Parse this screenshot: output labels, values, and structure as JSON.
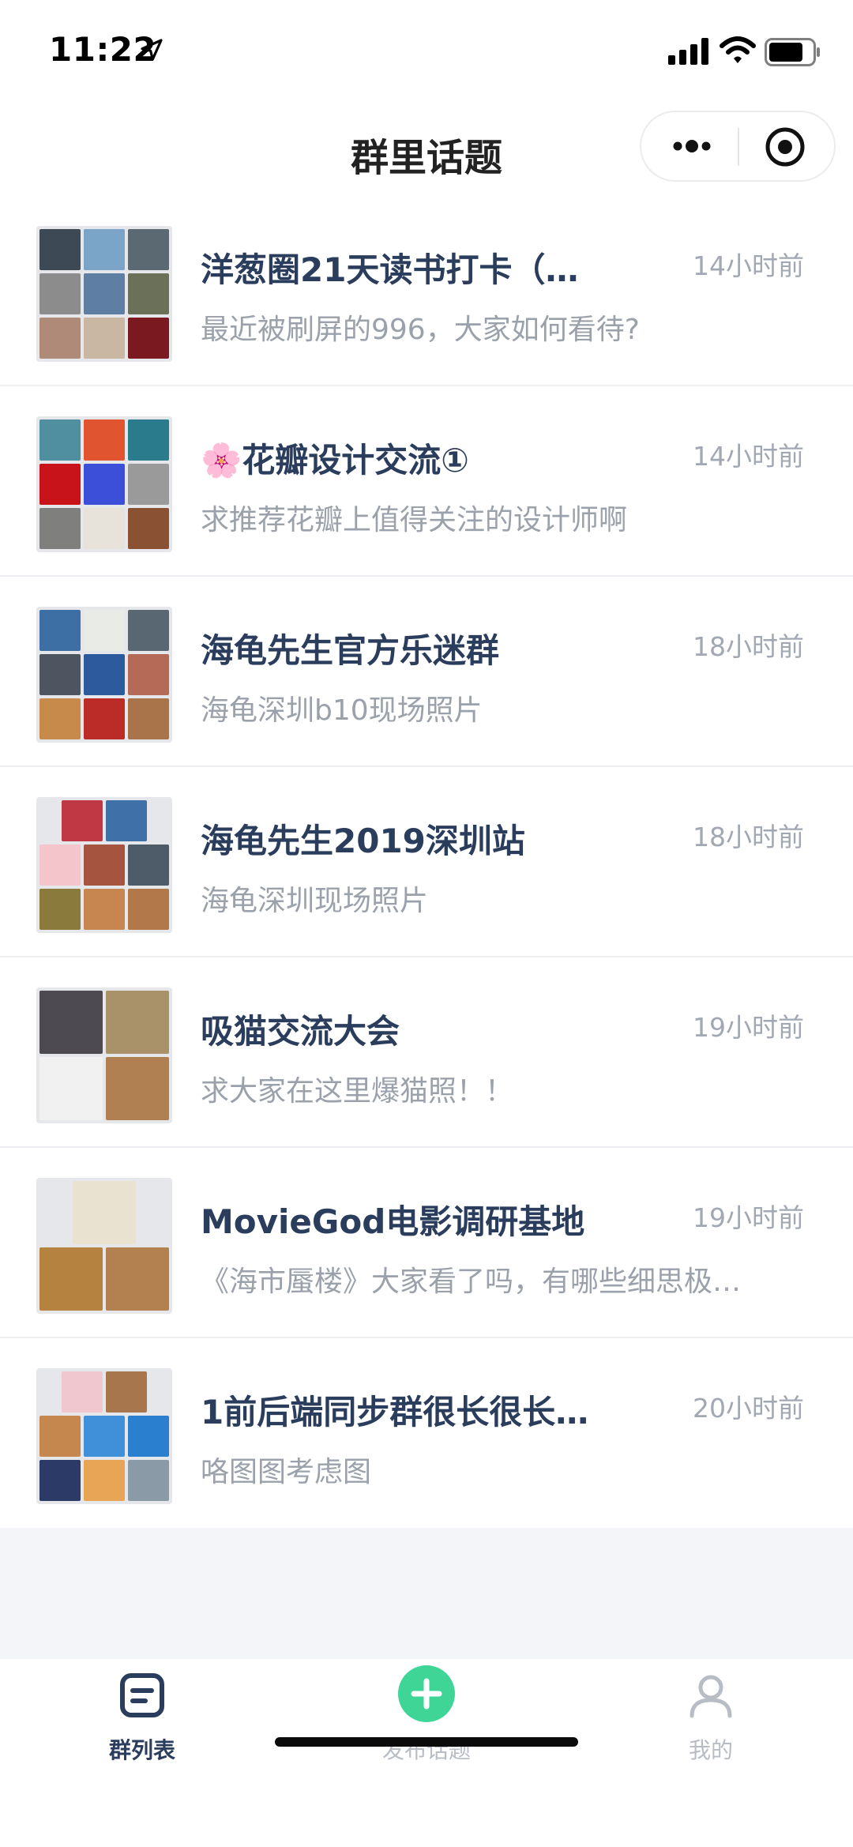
{
  "status_bar": {
    "time": "11:22"
  },
  "nav": {
    "title": "群里话题"
  },
  "groups": [
    {
      "name": "洋葱圈21天读书打卡（…",
      "time": "14小时前",
      "desc": "最近被刷屏的996，大家如何看待?",
      "avatar_colors": [
        "#3d4a56",
        "#7aa4c8",
        "#5b6a72",
        "#8c8c8c",
        "#5f7ea3",
        "#6b7058",
        "#b08a78",
        "#c9b7a4",
        "#7a1a20"
      ]
    },
    {
      "name": "🌸花瓣设计交流①",
      "time": "14小时前",
      "desc": "求推荐花瓣上值得关注的设计师啊",
      "avatar_colors": [
        "#4f8fa0",
        "#e0552f",
        "#2a7c8c",
        "#c9131b",
        "#3b4fd8",
        "#9a9a9a",
        "#7f807d",
        "#e7e2da",
        "#8a5232"
      ]
    },
    {
      "name": "海龟先生官方乐迷群",
      "time": "18小时前",
      "desc": "海龟深圳b10现场照片",
      "avatar_colors": [
        "#3d6fa5",
        "#e9ebe6",
        "#596772",
        "#4f5560",
        "#2c5a9c",
        "#b46a57",
        "#c88a4a",
        "#bb2c28",
        "#a9744a"
      ]
    },
    {
      "name": "海龟先生2019深圳站",
      "time": "18小时前",
      "desc": "海龟深圳现场照片",
      "avatar_colors": [
        "#c13845",
        "#3f71a8",
        "#f4c6cc",
        "#a5553f",
        "#4e5b68",
        "#8a7a3c",
        "#c7864f",
        "#b3784a"
      ]
    },
    {
      "name": "吸猫交流大会",
      "time": "19小时前",
      "desc": "求大家在这里爆猫照！！",
      "avatar_colors": [
        "#4e4a52",
        "#a9916a",
        "#f1f1f1",
        "#b07f52"
      ]
    },
    {
      "name": "MovieGod电影调研基地",
      "time": "19小时前",
      "desc": "《海市蜃楼》大家看了吗，有哪些细思极…",
      "avatar_colors": [
        "#e9e2d1",
        "#b5833f",
        "#b3804f"
      ]
    },
    {
      "name": "1前后端同步群很长很长…",
      "time": "20小时前",
      "desc": "咯图图考虑图",
      "avatar_colors": [
        "#f1c7cf",
        "#a8764c",
        "#c5874e",
        "#3f8fd9",
        "#2b7fcf",
        "#2b3a66",
        "#e9a556",
        "#8a9aa6"
      ]
    }
  ],
  "tabs": [
    {
      "label": "群列表",
      "icon": "list-icon",
      "active": true
    },
    {
      "label": "发布话题",
      "icon": "plus-circle-icon",
      "active": false
    },
    {
      "label": "我的",
      "icon": "user-icon",
      "active": false
    }
  ],
  "colors": {
    "accent_green": "#3ed596",
    "active_tab": "#2b3d5c",
    "inactive_tab": "#b7bcc5"
  }
}
